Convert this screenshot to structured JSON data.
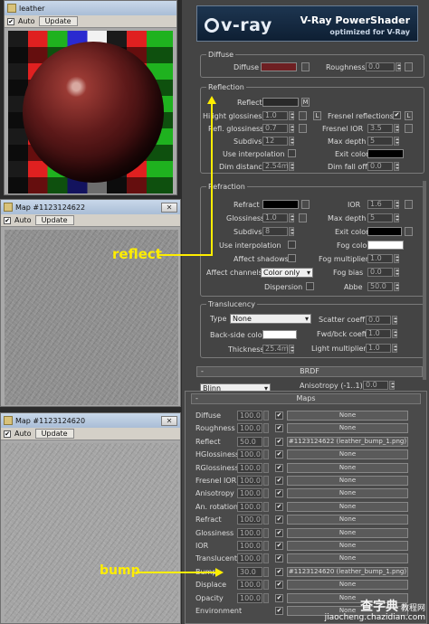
{
  "material_window": {
    "title": "leather",
    "auto_label": "Auto",
    "update_label": "Update"
  },
  "map_window_1": {
    "title": "Map #1123124622",
    "auto_label": "Auto",
    "update_label": "Update"
  },
  "map_window_2": {
    "title": "Map #1123124620",
    "auto_label": "Auto",
    "update_label": "Update"
  },
  "banner": {
    "logo": "v-ray",
    "title": "V-Ray PowerShader",
    "subtitle": "optimized for V-Ray"
  },
  "diffuse": {
    "group": "Diffuse",
    "diffuse_label": "Diffuse",
    "diffuse_color": "#6e1f22",
    "roughness_label": "Roughness",
    "roughness_value": "0.0"
  },
  "reflection": {
    "group": "Reflection",
    "reflect_label": "Reflect",
    "reflect_map_button": "M",
    "hilight_glossiness_label": "Hilight glossiness",
    "hilight_glossiness_value": "1.0",
    "hilight_lock": "L",
    "refl_glossiness_label": "Refl. glossiness",
    "refl_glossiness_value": "0.7",
    "subdivs_label": "Subdivs",
    "subdivs_value": "12",
    "use_interpolation_label": "Use interpolation",
    "dim_distance_label": "Dim distance",
    "dim_distance_value": "2.54m",
    "fresnel_reflections_label": "Fresnel reflections",
    "fresnel_reflections_checked": "✔",
    "fresnel_lock": "L",
    "fresnel_ior_label": "Fresnel IOR",
    "fresnel_ior_value": "3.5",
    "max_depth_label": "Max depth",
    "max_depth_value": "5",
    "exit_color_label": "Exit color",
    "dim_falloff_label": "Dim fall off",
    "dim_falloff_value": "0.0"
  },
  "refraction": {
    "group": "Refraction",
    "refract_label": "Refract",
    "glossiness_label": "Glossiness",
    "glossiness_value": "1.0",
    "subdivs_label": "Subdivs",
    "subdivs_value": "8",
    "use_interpolation_label": "Use interpolation",
    "affect_shadows_label": "Affect shadows",
    "affect_channels_label": "Affect channels",
    "affect_channels_value": "Color only",
    "dispersion_label": "Dispersion",
    "ior_label": "IOR",
    "ior_value": "1.6",
    "max_depth_label": "Max depth",
    "max_depth_value": "5",
    "exit_color_label": "Exit color",
    "fog_color_label": "Fog color",
    "fog_multiplier_label": "Fog multiplier",
    "fog_multiplier_value": "1.0",
    "fog_bias_label": "Fog bias",
    "fog_bias_value": "0.0",
    "abbe_label": "Abbe",
    "abbe_value": "50.0"
  },
  "translucency": {
    "group": "Translucency",
    "type_label": "Type",
    "type_value": "None",
    "backside_color_label": "Back-side color",
    "thickness_label": "Thickness",
    "thickness_value": "25.4m",
    "scatter_coeff_label": "Scatter coeff",
    "scatter_coeff_value": "0.0",
    "fwd_bck_coeff_label": "Fwd/bck coeff",
    "fwd_bck_coeff_value": "1.0",
    "light_multiplier_label": "Light multiplier",
    "light_multiplier_value": "1.0"
  },
  "brdf": {
    "rollout_minus": "-",
    "rollout_title": "BRDF",
    "type_value": "Blinn",
    "anisotropy_label": "Anisotropy (-1..1)",
    "anisotropy_value": "0.0"
  },
  "maps": {
    "rollout_minus": "-",
    "rollout_title": "Maps",
    "rows": [
      {
        "name": "Diffuse",
        "value": "100.0",
        "enabled": "✔",
        "slot": "None"
      },
      {
        "name": "Roughness",
        "value": "100.0",
        "enabled": "✔",
        "slot": "None"
      },
      {
        "name": "Reflect",
        "value": "50.0",
        "enabled": "✔",
        "slot": "#1123124622 (leather_bump_1.png)"
      },
      {
        "name": "HGlossiness",
        "value": "100.0",
        "enabled": "✔",
        "slot": "None"
      },
      {
        "name": "RGlossiness",
        "value": "100.0",
        "enabled": "✔",
        "slot": "None"
      },
      {
        "name": "Fresnel IOR",
        "value": "100.0",
        "enabled": "✔",
        "slot": "None"
      },
      {
        "name": "Anisotropy",
        "value": "100.0",
        "enabled": "✔",
        "slot": "None"
      },
      {
        "name": "An. rotation",
        "value": "100.0",
        "enabled": "✔",
        "slot": "None"
      },
      {
        "name": "Refract",
        "value": "100.0",
        "enabled": "✔",
        "slot": "None"
      },
      {
        "name": "Glossiness",
        "value": "100.0",
        "enabled": "✔",
        "slot": "None"
      },
      {
        "name": "IOR",
        "value": "100.0",
        "enabled": "✔",
        "slot": "None"
      },
      {
        "name": "Translucent",
        "value": "100.0",
        "enabled": "✔",
        "slot": "None"
      },
      {
        "name": "Bump",
        "value": "30.0",
        "enabled": "✔",
        "slot": "#1123124620 (leather_bump_1.png)"
      },
      {
        "name": "Displace",
        "value": "100.0",
        "enabled": "✔",
        "slot": "None"
      },
      {
        "name": "Opacity",
        "value": "100.0",
        "enabled": "✔",
        "slot": "None"
      },
      {
        "name": "Environment",
        "value": "",
        "enabled": "✔",
        "slot": "None"
      }
    ]
  },
  "callouts": {
    "reflect": "reflect",
    "bump": "bump",
    "color": "#ffee00"
  },
  "watermark": {
    "line1": "查字典",
    "line1_sub": "教程网",
    "line2": "jiaocheng.chazidian.com"
  }
}
